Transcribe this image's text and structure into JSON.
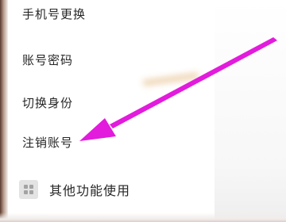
{
  "menu": {
    "items": [
      {
        "label": "手机号更换"
      },
      {
        "label": "账号密码"
      },
      {
        "label": "切换身份"
      },
      {
        "label": "注销账号"
      }
    ],
    "other": {
      "label": "其他功能使用",
      "icon": "grid-icon"
    }
  },
  "annotation": {
    "arrow_color": "#e21bdc",
    "target": "注销账号"
  }
}
